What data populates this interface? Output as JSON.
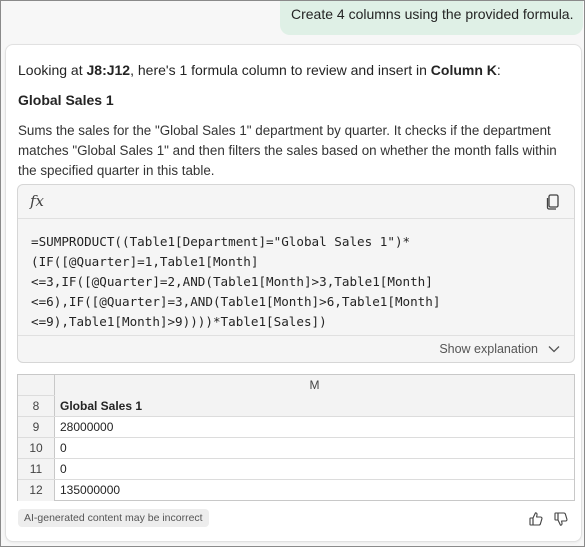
{
  "user_message": "Create 4 columns using the provided formula.",
  "response": {
    "intro_prefix": "Looking at ",
    "intro_range": "J8:J12",
    "intro_middle": ", here's 1 formula column to review and insert in ",
    "intro_column": "Column K",
    "intro_suffix": ":",
    "column_title": "Global Sales 1",
    "description": "Sums the sales for the \"Global Sales 1\" department by quarter. It checks if the department matches \"Global Sales 1\" and then filters the sales based on whether the month falls within the specified quarter in this table.",
    "fx_label": "fx",
    "formula_lines": [
      "=SUMPRODUCT((Table1[Department]=\"Global Sales 1\")*",
      "(IF([@Quarter]=1,Table1[Month]",
      "<=3,IF([@Quarter]=2,AND(Table1[Month]>3,Table1[Month]",
      "<=6),IF([@Quarter]=3,AND(Table1[Month]>6,Table1[Month]",
      "<=9),Table1[Month]>9))))*Table1[Sales])"
    ],
    "show_explanation_label": "Show explanation",
    "preview_grid": {
      "column_header": "M",
      "rows": [
        {
          "row": "8",
          "value": "Global Sales 1"
        },
        {
          "row": "9",
          "value": "28000000"
        },
        {
          "row": "10",
          "value": "0"
        },
        {
          "row": "11",
          "value": "0"
        },
        {
          "row": "12",
          "value": "135000000"
        }
      ]
    },
    "disclaimer": "AI-generated content may be incorrect"
  },
  "icons": {
    "copy": "copy-icon",
    "chevron": "chevron-down-icon",
    "thumbs_up": "thumbs-up-icon",
    "thumbs_down": "thumbs-down-icon"
  },
  "colors": {
    "user_bubble": "#dff0e6",
    "card": "#ffffff",
    "formula_bg": "#f5f5f5"
  }
}
